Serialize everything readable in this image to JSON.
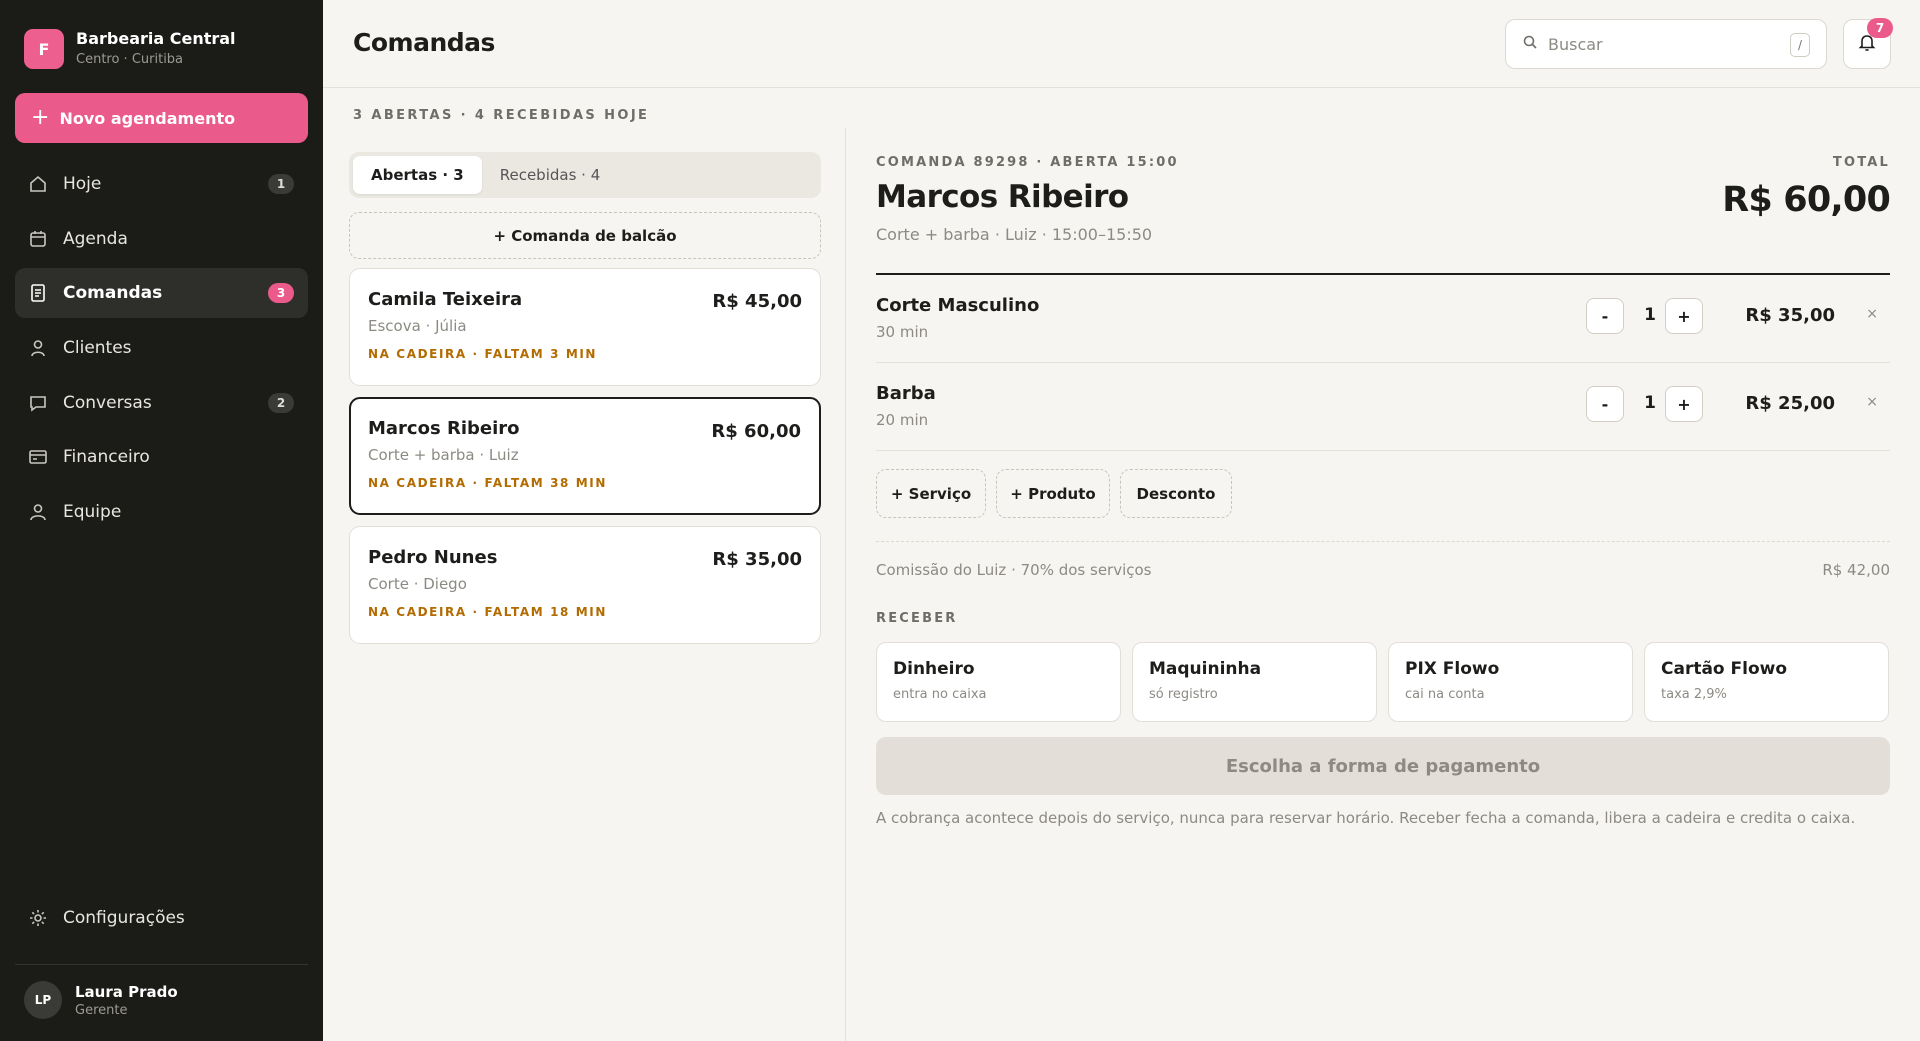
{
  "sidebar": {
    "brand": {
      "initial": "F",
      "name": "Barbearia Central",
      "location": "Centro · Curitiba"
    },
    "new_button": {
      "icon": "plus-icon",
      "label": "Novo agendamento"
    },
    "items": [
      {
        "icon": "home-icon",
        "label": "Hoje",
        "badge": "1",
        "active": false
      },
      {
        "icon": "calendar-icon",
        "label": "Agenda",
        "badge": null,
        "active": false
      },
      {
        "icon": "receipt-icon",
        "label": "Comandas",
        "badge": "3",
        "active": true
      },
      {
        "icon": "person-icon",
        "label": "Clientes",
        "badge": null,
        "active": false
      },
      {
        "icon": "chat-icon",
        "label": "Conversas",
        "badge": "2",
        "active": false
      },
      {
        "icon": "card-icon",
        "label": "Financeiro",
        "badge": null,
        "active": false
      },
      {
        "icon": "team-icon",
        "label": "Equipe",
        "badge": null,
        "active": false
      }
    ],
    "settings": {
      "icon": "gear-icon",
      "label": "Configurações"
    },
    "user": {
      "initials": "LP",
      "name": "Laura Prado",
      "role": "Gerente"
    }
  },
  "header": {
    "title": "Comandas",
    "search": {
      "placeholder": "Buscar",
      "shortcut": "/"
    },
    "notifications": {
      "count": "7"
    }
  },
  "orders": {
    "summary": "3 ABERTAS · 4 RECEBIDAS HOJE",
    "tabs": [
      {
        "label": "Abertas · 3",
        "active": true
      },
      {
        "label": "Recebidas · 4",
        "active": false
      }
    ],
    "counter_button": "+ Comanda de balcão",
    "list": [
      {
        "name": "Camila Teixeira",
        "price": "R$ 45,00",
        "service": "Escova · Júlia",
        "status": "NA CADEIRA · FALTAM 3 MIN",
        "selected": false
      },
      {
        "name": "Marcos Ribeiro",
        "price": "R$ 60,00",
        "service": "Corte + barba · Luiz",
        "status": "NA CADEIRA · FALTAM 38 MIN",
        "selected": true
      },
      {
        "name": "Pedro Nunes",
        "price": "R$ 35,00",
        "service": "Corte · Diego",
        "status": "NA CADEIRA · FALTAM 18 MIN",
        "selected": false
      }
    ]
  },
  "detail": {
    "meta": "COMANDA 89298 · ABERTA 15:00",
    "total_label": "TOTAL",
    "client": "Marcos Ribeiro",
    "total": "R$ 60,00",
    "subtitle": "Corte + barba · Luiz · 15:00–15:50",
    "items": [
      {
        "name": "Corte Masculino",
        "duration": "30 min",
        "qty": "1",
        "price": "R$ 35,00"
      },
      {
        "name": "Barba",
        "duration": "20 min",
        "qty": "1",
        "price": "R$ 25,00"
      }
    ],
    "qty_minus": "-",
    "qty_plus": "+",
    "remove": "×",
    "add_buttons": [
      "+ Serviço",
      "+ Produto",
      "Desconto"
    ],
    "commission": {
      "label": "Comissão do Luiz · 70% dos serviços",
      "value": "R$ 42,00"
    },
    "receive_label": "RECEBER",
    "payment_options": [
      {
        "name": "Dinheiro",
        "note": "entra no caixa"
      },
      {
        "name": "Maquininha",
        "note": "só registro"
      },
      {
        "name": "PIX Flowo",
        "note": "cai na conta"
      },
      {
        "name": "Cartão Flowo",
        "note": "taxa 2,9%"
      }
    ],
    "pay_button": "Escolha a forma de pagamento",
    "footnote": "A cobrança acontece depois do serviço, nunca para reservar horário. Receber fecha a comanda, libera a cadeira e credita o caixa."
  },
  "colors": {
    "accent": "#ea5b8c",
    "sidebar_bg": "#1b1c18",
    "status": "#b36b00",
    "page_bg": "#f7f5f1"
  }
}
